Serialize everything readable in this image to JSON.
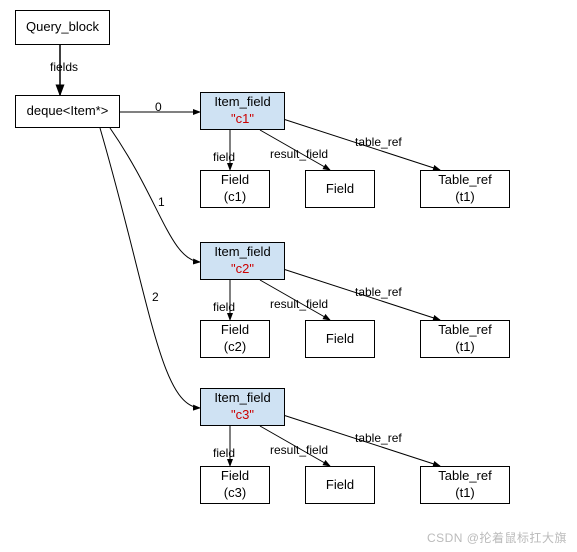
{
  "nodes": {
    "queryBlock": {
      "label": "Query_block"
    },
    "deque": {
      "label": "deque<Item*>"
    },
    "itemField0": {
      "title": "Item_field",
      "value": "\"c1\""
    },
    "itemField1": {
      "title": "Item_field",
      "value": "\"c2\""
    },
    "itemField2": {
      "title": "Item_field",
      "value": "\"c3\""
    },
    "fieldA0": {
      "l1": "Field",
      "l2": "(c1)"
    },
    "fieldB0": {
      "l1": "Field"
    },
    "tableRef0": {
      "l1": "Table_ref",
      "l2": "(t1)"
    },
    "fieldA1": {
      "l1": "Field",
      "l2": "(c2)"
    },
    "fieldB1": {
      "l1": "Field"
    },
    "tableRef1": {
      "l1": "Table_ref",
      "l2": "(t1)"
    },
    "fieldA2": {
      "l1": "Field",
      "l2": "(c3)"
    },
    "fieldB2": {
      "l1": "Field"
    },
    "tableRef2": {
      "l1": "Table_ref",
      "l2": "(t1)"
    }
  },
  "edgeLabels": {
    "fields": "fields",
    "e0": "0",
    "e1": "1",
    "e2": "2",
    "field": "field",
    "resultField": "result_field",
    "tableRef": "table_ref"
  },
  "watermark": "CSDN @抡着鼠标扛大旗",
  "chart_data": {
    "type": "diagram",
    "title": "",
    "description": "Object graph: Query_block fields deque<Item*> pointing to three Item_field nodes (c1,c2,c3), each pointing to Field/result_field/table_ref children",
    "nodes": [
      {
        "id": "Query_block",
        "label": "Query_block"
      },
      {
        "id": "deque",
        "label": "deque<Item*>"
      },
      {
        "id": "IF0",
        "label": "Item_field \"c1\""
      },
      {
        "id": "IF1",
        "label": "Item_field \"c2\""
      },
      {
        "id": "IF2",
        "label": "Item_field \"c3\""
      },
      {
        "id": "F0a",
        "label": "Field (c1)"
      },
      {
        "id": "F0b",
        "label": "Field"
      },
      {
        "id": "T0",
        "label": "Table_ref (t1)"
      },
      {
        "id": "F1a",
        "label": "Field (c2)"
      },
      {
        "id": "F1b",
        "label": "Field"
      },
      {
        "id": "T1",
        "label": "Table_ref (t1)"
      },
      {
        "id": "F2a",
        "label": "Field (c3)"
      },
      {
        "id": "F2b",
        "label": "Field"
      },
      {
        "id": "T2",
        "label": "Table_ref (t1)"
      }
    ],
    "edges": [
      {
        "from": "Query_block",
        "to": "deque",
        "label": "fields"
      },
      {
        "from": "deque",
        "to": "IF0",
        "label": "0"
      },
      {
        "from": "deque",
        "to": "IF1",
        "label": "1"
      },
      {
        "from": "deque",
        "to": "IF2",
        "label": "2"
      },
      {
        "from": "IF0",
        "to": "F0a",
        "label": "field"
      },
      {
        "from": "IF0",
        "to": "F0b",
        "label": "result_field"
      },
      {
        "from": "IF0",
        "to": "T0",
        "label": "table_ref"
      },
      {
        "from": "IF1",
        "to": "F1a",
        "label": "field"
      },
      {
        "from": "IF1",
        "to": "F1b",
        "label": "result_field"
      },
      {
        "from": "IF1",
        "to": "T1",
        "label": "table_ref"
      },
      {
        "from": "IF2",
        "to": "F2a",
        "label": "field"
      },
      {
        "from": "IF2",
        "to": "F2b",
        "label": "result_field"
      },
      {
        "from": "IF2",
        "to": "T2",
        "label": "table_ref"
      }
    ]
  }
}
